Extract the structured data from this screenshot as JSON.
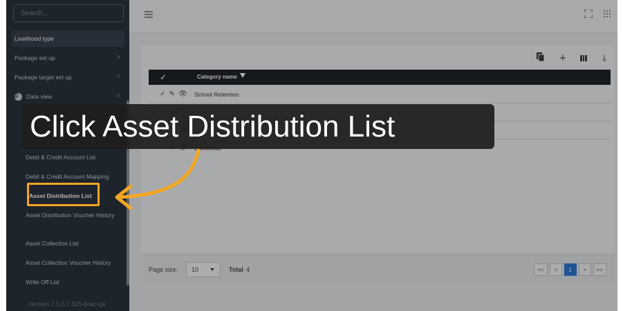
{
  "sidebar": {
    "search_placeholder": "Search...",
    "items": [
      {
        "label": "Livelihood type"
      },
      {
        "label": "Package set up",
        "chevron": ">"
      },
      {
        "label": "Package target set up",
        "chevron": ">"
      },
      {
        "label": "Data view",
        "chevron": ">"
      }
    ],
    "sub_items": [
      {
        "label": "Debit & Credit Account List"
      },
      {
        "label": "Debit & Credit Account Mapping"
      },
      {
        "label": "Asset Distribution List"
      },
      {
        "label": "Asset Distribution Voucher History"
      },
      {
        "label": "Asset Collection List"
      },
      {
        "label": "Asset Collection Voucher History"
      },
      {
        "label": "Write Off List"
      }
    ],
    "version": "Version 7.5.0.7.325-brac-qa"
  },
  "grid": {
    "header": {
      "check": "✓",
      "category": "Category name"
    },
    "rows": [
      {
        "actions": "✓ ✎ 👁",
        "category": "School Retention"
      },
      {
        "actions": "✓ ✎ 👁",
        "category": ""
      },
      {
        "actions": "✓ ✎ 👁",
        "category": ""
      },
      {
        "actions": "✓ ✎ 👁",
        "category": "Livelihood"
      }
    ]
  },
  "toolbar": {
    "icons": [
      "copy-icon",
      "add-icon",
      "columns-icon",
      "download-icon"
    ],
    "add_glyph": "+",
    "download_glyph": "⤓"
  },
  "pager": {
    "page_size_label": "Page size:",
    "page_size_value": "10",
    "total_label": "Total",
    "total_value": "4",
    "buttons": [
      "<<",
      "<",
      "1",
      ">",
      ">>"
    ],
    "current_page": "1"
  },
  "overlay": {
    "instruction": "Click Asset Distribution List",
    "accent_color": "#f5a623"
  }
}
